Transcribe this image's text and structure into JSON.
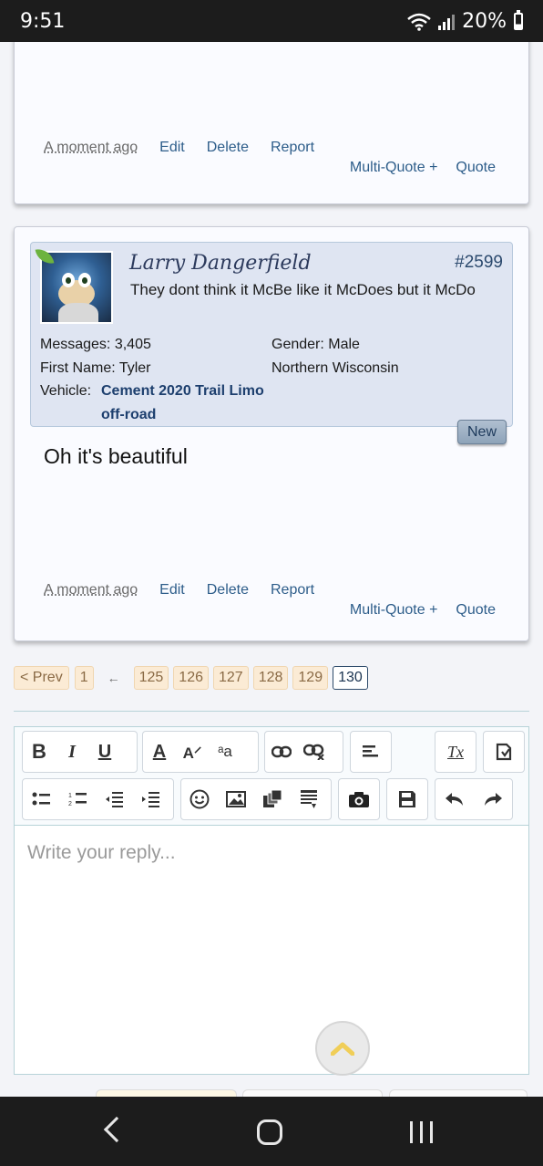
{
  "status": {
    "time": "9:51",
    "battery": "20%"
  },
  "prev_post": {
    "time": "A moment ago",
    "edit": "Edit",
    "delete": "Delete",
    "report": "Report",
    "multiquote": "Multi-Quote +",
    "quote": "Quote"
  },
  "post": {
    "username": "Larry Dangerfield",
    "number": "#2599",
    "user_title": "They dont think it McBe like it McDoes but it McDo",
    "messages_label": "Messages:",
    "messages_value": "3,405",
    "gender_label": "Gender:",
    "gender_value": "Male",
    "firstname_label": "First Name:",
    "firstname_value": "Tyler",
    "location": "Northern Wisconsin",
    "vehicle_label": "Vehicle:",
    "vehicle_line1": "Cement 2020 Trail Limo",
    "vehicle_line2": "off-road",
    "new_badge": "New",
    "message": "Oh it's beautiful",
    "time": "A moment ago",
    "edit": "Edit",
    "delete": "Delete",
    "report": "Report",
    "multiquote": "Multi-Quote +",
    "quote": "Quote"
  },
  "pagination": {
    "prev": "< Prev",
    "first": "1",
    "arrow": "←",
    "pages": [
      "125",
      "126",
      "127",
      "128",
      "129",
      "130"
    ],
    "current": "130"
  },
  "editor": {
    "placeholder": "Write your reply...",
    "buttons": {
      "bold": "B",
      "italic": "I",
      "underline": "U",
      "font_color": "A",
      "font_size": "A⸍",
      "font_family": "ᵃa",
      "remove_format": "Tx"
    }
  },
  "icons": {
    "bold": "bold-icon",
    "italic": "italic-icon",
    "underline": "underline-icon",
    "link": "link-icon",
    "unlink": "unlink-icon",
    "align": "align-icon",
    "emoji": "emoji-icon",
    "image": "image-icon",
    "camera": "camera-icon",
    "save": "save-icon",
    "undo": "undo-icon",
    "redo": "redo-icon"
  }
}
